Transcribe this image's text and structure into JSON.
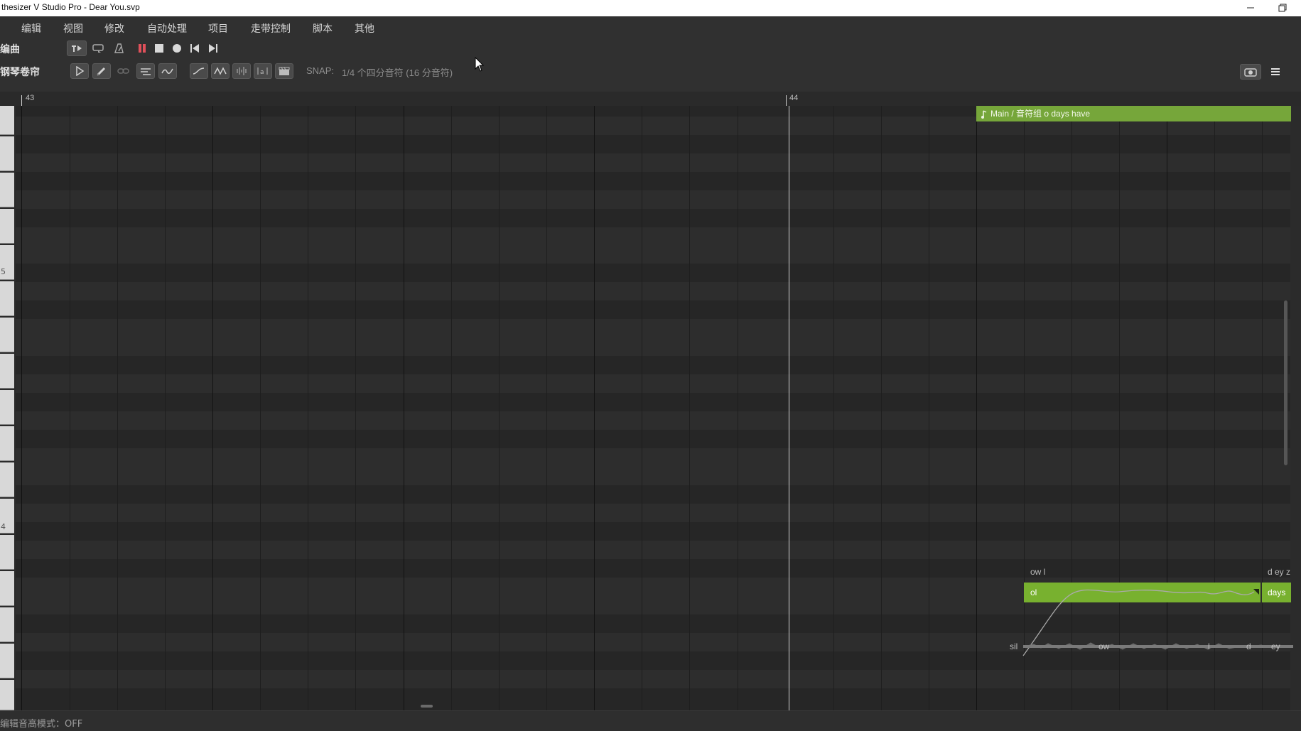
{
  "window": {
    "title": "thesizer V Studio Pro - Dear You.svp",
    "minimize_icon": "minimize-icon",
    "restore_icon": "restore-icon"
  },
  "menu": [
    "编辑",
    "视图",
    "修改",
    "自动处理",
    "项目",
    "走带控制",
    "脚本",
    "其他"
  ],
  "transport": {
    "label": "编曲",
    "buttons": [
      "play-mode-icon",
      "loop-icon",
      "metronome-icon",
      "pause-icon",
      "stop-icon",
      "record-icon",
      "skip-to-start-icon",
      "skip-to-end-icon"
    ]
  },
  "piano_toolbar": {
    "label": "钢琴卷帘",
    "tools": [
      "select-tool-icon",
      "pencil-tool-icon",
      "link-tool-icon",
      "pitch-tool-icon",
      "vibrato-tool-icon",
      "curve-tool-icon",
      "wave-tool-icon",
      "audio-tool-icon",
      "lyrics-tool-icon",
      "clapper-icon"
    ],
    "snap_label": "SNAP:",
    "snap_value": "1/4 个四分音符 (16 分音符)",
    "right_icons": [
      "camera-icon",
      "hamburger-menu-icon"
    ]
  },
  "ruler": {
    "bars": [
      {
        "label": "43",
        "beat": 0
      },
      {
        "label": "44",
        "beat": 4
      }
    ]
  },
  "keyboard": {
    "octave_labels": [
      "5",
      "4"
    ]
  },
  "note_group": {
    "label": "Main / 音符组 o days have",
    "icon": "note-group-icon"
  },
  "notes": [
    {
      "lyric": "ol",
      "phonemes": "ow l"
    },
    {
      "lyric": "days",
      "phonemes": "d ey z"
    }
  ],
  "phoneme_track": [
    "sil",
    "ow",
    "l",
    "d",
    "ey"
  ],
  "status": {
    "text": "编辑音高模式：OFF"
  },
  "colors": {
    "note": "#78b12f",
    "group_header": "#76a63a",
    "background": "#2b2b2b",
    "playhead": "#d0d0d0"
  }
}
